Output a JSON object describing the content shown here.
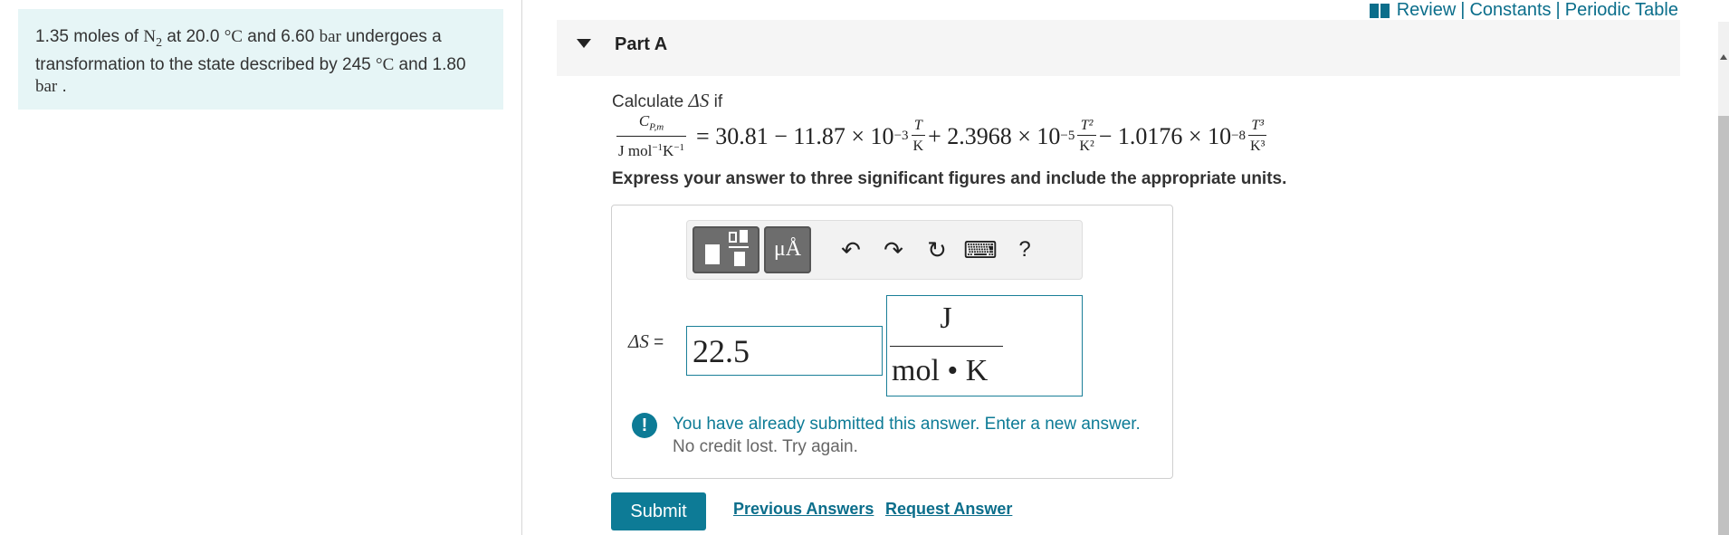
{
  "problem": {
    "text_1": "1.35 moles of ",
    "species": "N",
    "species_sub": "2",
    "text_2": " at 20.0 ",
    "deg_unit": "°C",
    "text_3": " and 6.60 ",
    "bar_unit": "bar",
    "text_4": " undergoes a transformation to the state described by 245 ",
    "text_5": " and 1.80 ",
    "text_6": " ."
  },
  "top_links": {
    "review": "Review",
    "constants": "Constants",
    "periodic_table": "Periodic Table",
    "separator": "|"
  },
  "part": {
    "title": "Part A"
  },
  "question": {
    "intro": "Calculate ",
    "symbol": "ΔS",
    "intro_end": " if",
    "cp_symbol": "C",
    "cp_sub": "P,m",
    "cp_units": "J mol",
    "cp_units_exp1": "−1",
    "cp_units_k": "K",
    "cp_units_exp2": "−1",
    "eq_term1": "= 30.81 − 11.87 × 10",
    "eq_exp1": "−3",
    "frac1_num": "T",
    "frac1_den": "K",
    "eq_term2": "+ 2.3968 × 10",
    "eq_exp2": "−5",
    "frac2_num": "T²",
    "frac2_den": "K²",
    "eq_term3": "− 1.0176 × 10",
    "eq_exp3": "−8",
    "frac3_num": "T³",
    "frac3_den": "K³",
    "instructions": "Express your answer to three significant figures and include the appropriate units."
  },
  "toolbar": {
    "units_label": "μÅ",
    "undo_glyph": "↶",
    "redo_glyph": "↷",
    "reset_glyph": "↻",
    "keyboard_glyph": "⌨",
    "help_label": "?",
    "icons": [
      "templates-icon",
      "units-icon",
      "undo-icon",
      "redo-icon",
      "reset-icon",
      "keyboard-icon",
      "help-icon"
    ]
  },
  "answer": {
    "label_symbol": "ΔS",
    "label_eq": " =",
    "value": "22.5",
    "units_numerator": "J",
    "units_denominator": "mol • K"
  },
  "feedback": {
    "icon": "!",
    "message": "You have already submitted this answer. Enter a new answer.",
    "sub_message": "No credit lost. Try again."
  },
  "actions": {
    "submit": "Submit",
    "previous_answers": "Previous Answers",
    "request_answer": "Request Answer"
  },
  "colors": {
    "accent": "#0d7b96",
    "intro_bg": "#e6f5f6",
    "header_bg": "#f5f5f5"
  }
}
